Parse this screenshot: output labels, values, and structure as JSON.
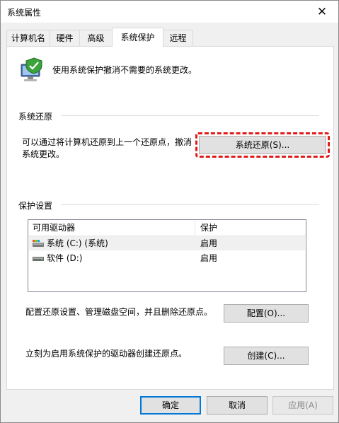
{
  "window": {
    "title": "系统属性",
    "close_glyph": "✕"
  },
  "tabs": [
    {
      "label": "计算机名",
      "active": false
    },
    {
      "label": "硬件",
      "active": false
    },
    {
      "label": "高级",
      "active": false
    },
    {
      "label": "系统保护",
      "active": true
    },
    {
      "label": "远程",
      "active": false
    }
  ],
  "intro": {
    "text": "使用系统保护撤消不需要的系统更改。",
    "icon": "computer-shield-icon"
  },
  "restore": {
    "section_title": "系统还原",
    "description_line1": "可以通过将计算机还原到上一个还原点，撤消",
    "description_line2": "系统更改。",
    "button_label": "系统还原(S)..."
  },
  "protection": {
    "section_title": "保护设置",
    "columns": [
      "可用驱动器",
      "保护"
    ],
    "drives": [
      {
        "name": "系统 (C:) (系统)",
        "protection": "启用",
        "icon": "system-drive-icon"
      },
      {
        "name": "软件 (D:)",
        "protection": "启用",
        "icon": "drive-icon"
      }
    ],
    "configure_text": "配置还原设置、管理磁盘空间，并且删除还原点。",
    "configure_button": "配置(O)...",
    "create_text": "立刻为启用系统保护的驱动器创建还原点。",
    "create_button": "创建(C)..."
  },
  "footer": {
    "ok": "确定",
    "cancel": "取消",
    "apply": "应用(A)"
  },
  "colors": {
    "highlight": "#e01b1b",
    "accent": "#0078d7"
  }
}
